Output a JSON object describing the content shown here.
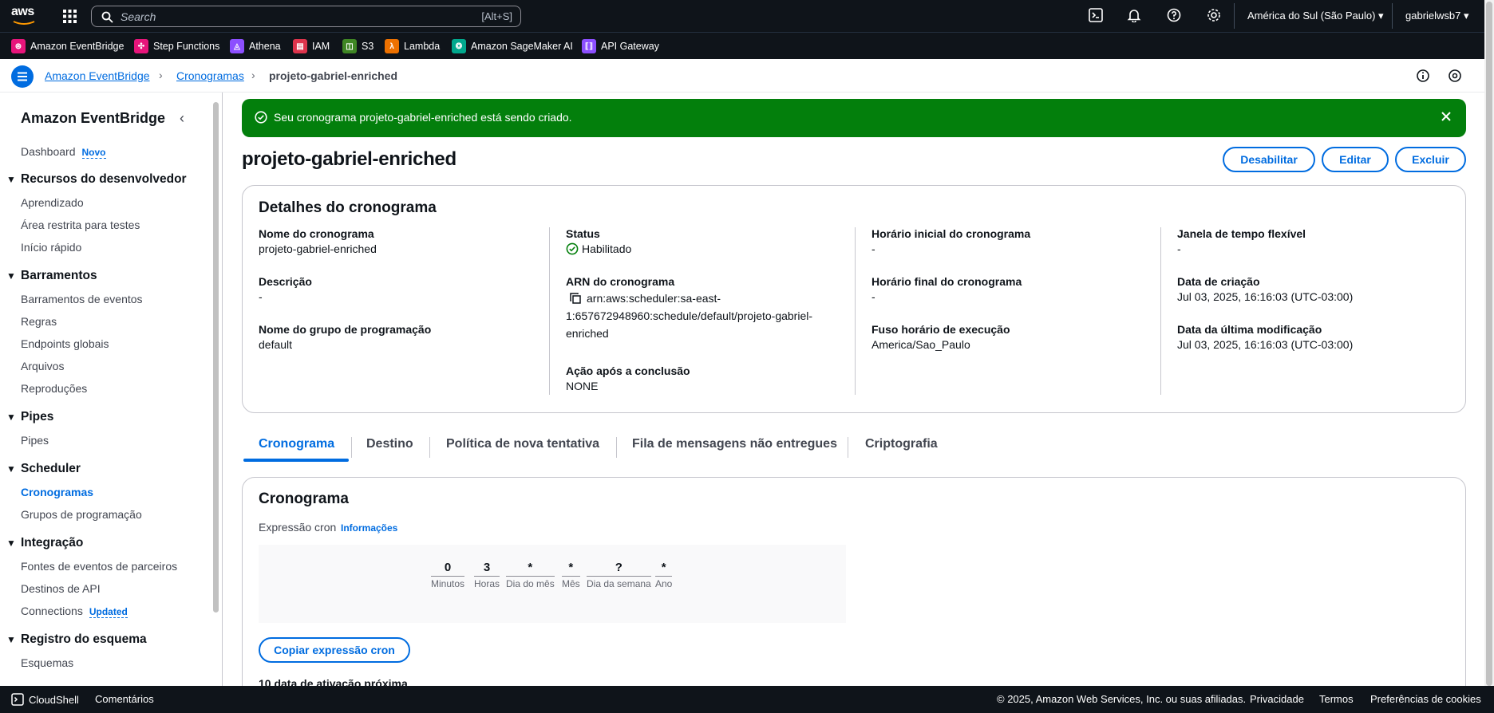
{
  "topnav": {
    "logo": "aws",
    "search_placeholder": "Search",
    "search_shortcut": "[Alt+S]",
    "region": "América do Sul (São Paulo)",
    "user": "gabrielwsb7",
    "icons": [
      "cloudshell-icon",
      "bell-icon",
      "help-icon",
      "gear-icon"
    ]
  },
  "favorites": [
    {
      "label": "Amazon EventBridge",
      "color": "#e7157b"
    },
    {
      "label": "Step Functions",
      "color": "#e7157b"
    },
    {
      "label": "Athena",
      "color": "#8c4fff"
    },
    {
      "label": "IAM",
      "color": "#dd344c"
    },
    {
      "label": "S3",
      "color": "#3f8624"
    },
    {
      "label": "Lambda",
      "color": "#ed7100"
    },
    {
      "label": "Amazon SageMaker AI",
      "color": "#01a88d"
    },
    {
      "label": "API Gateway",
      "color": "#8c4fff"
    }
  ],
  "breadcrumb": {
    "items": [
      "Amazon EventBridge",
      "Cronogramas",
      "projeto-gabriel-enriched"
    ]
  },
  "sidebar": {
    "title": "Amazon EventBridge",
    "dashboard": "Dashboard",
    "dashboard_badge": "Novo",
    "sections": [
      {
        "head": "Recursos do desenvolvedor",
        "items": [
          "Aprendizado",
          "Área restrita para testes",
          "Início rápido"
        ]
      },
      {
        "head": "Barramentos",
        "items": [
          "Barramentos de eventos",
          "Regras",
          "Endpoints globais",
          "Arquivos",
          "Reproduções"
        ]
      },
      {
        "head": "Pipes",
        "items": [
          "Pipes"
        ]
      },
      {
        "head": "Scheduler",
        "items": [
          "Cronogramas",
          "Grupos de programação"
        ]
      },
      {
        "head": "Integração",
        "items": [
          "Fontes de eventos de parceiros",
          "Destinos de API",
          "Connections"
        ]
      },
      {
        "head": "Registro do esquema",
        "items": [
          "Esquemas"
        ]
      }
    ],
    "connections_badge": "Updated"
  },
  "flash": {
    "message": "Seu cronograma projeto-gabriel-enriched está sendo criado."
  },
  "page": {
    "title": "projeto-gabriel-enriched",
    "buttons": [
      "Desabilitar",
      "Editar",
      "Excluir"
    ]
  },
  "details": {
    "title": "Detalhes do cronograma",
    "schedule_name_label": "Nome do cronograma",
    "schedule_name": "projeto-gabriel-enriched",
    "description_label": "Descrição",
    "description": "-",
    "group_label": "Nome do grupo de programação",
    "group": "default",
    "status_label": "Status",
    "status": "Habilitado",
    "arn_label": "ARN do cronograma",
    "arn_line1": "arn:aws:scheduler:sa-east-",
    "arn_line2": "1:657672948960:schedule/default/projeto-gabriel-",
    "arn_line3": "enriched",
    "action_label": "Ação após a conclusão",
    "action": "NONE",
    "start_label": "Horário inicial do cronograma",
    "start": "-",
    "end_label": "Horário final do cronograma",
    "end": "-",
    "tz_label": "Fuso horário de execução",
    "tz": "America/Sao_Paulo",
    "flex_label": "Janela de tempo flexível",
    "flex": "-",
    "created_label": "Data de criação",
    "created": "Jul 03, 2025, 16:16:03 (UTC-03:00)",
    "modified_label": "Data da última modificação",
    "modified": "Jul 03, 2025, 16:16:03 (UTC-03:00)"
  },
  "tabs": [
    "Cronograma",
    "Destino",
    "Política de nova tentativa",
    "Fila de mensagens não entregues",
    "Criptografia"
  ],
  "schedule": {
    "title": "Cronograma",
    "cron_label": "Expressão cron",
    "info_link": "Informações",
    "cron_fields": [
      {
        "value": "0",
        "label": "Minutos"
      },
      {
        "value": "3",
        "label": "Horas"
      },
      {
        "value": "*",
        "label": "Dia do mês"
      },
      {
        "value": "*",
        "label": "Mês"
      },
      {
        "value": "?",
        "label": "Dia da semana"
      },
      {
        "value": "*",
        "label": "Ano"
      }
    ],
    "copy_button": "Copiar expressão cron",
    "next_label": "10 data de ativação próxima"
  },
  "footer": {
    "cloudshell": "CloudShell",
    "feedback": "Comentários",
    "copyright": "© 2025, Amazon Web Services, Inc. ou suas afiliadas.",
    "privacy": "Privacidade",
    "terms": "Termos",
    "cookies": "Preferências de cookies"
  }
}
